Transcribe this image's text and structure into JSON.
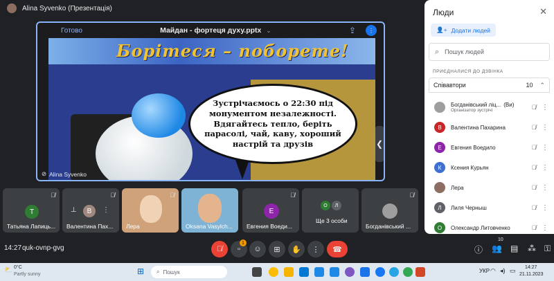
{
  "meeting": {
    "presenter_label": "Alina Syvenko (Презентація)",
    "stage_status": "Готово",
    "file_name": "Майдан - фортеця духу.pptx",
    "slide_headline": "Борітеся – поборете!",
    "slide_text": "Зустрічаємось о 22:30 під монументом незалежності. Вдягайтесь тепло, беріть парасолі, чай, каву, хороший настрій та друзів",
    "presenter_name": "Alina Syvenko"
  },
  "tiles": [
    {
      "name": "Татьяна Лапиць...",
      "initial": "T",
      "color": "#2e7d32"
    },
    {
      "name": "Валентина Пах...",
      "initial": "В",
      "color": "#a1887f"
    },
    {
      "name": "Лера",
      "initial": "",
      "color": ""
    },
    {
      "name": "Oksana Vasylch...",
      "initial": "",
      "color": ""
    },
    {
      "name": "Евгения Воеди...",
      "initial": "E",
      "color": "#8e24aa"
    },
    {
      "name": "Ще 3 особи",
      "initial": "",
      "color": ""
    },
    {
      "name": "Богданівський ...",
      "initial": "",
      "color": ""
    }
  ],
  "more_tile_initials": [
    "O",
    "Л"
  ],
  "bottom": {
    "time": "14:27",
    "meeting_code": "quk-ovnp-gvg",
    "participant_count": "10",
    "notification_badge": "1"
  },
  "people_panel": {
    "title": "Люди",
    "add_button": "Додати людей",
    "search_placeholder": "Пошук людей",
    "joined_header": "ПРИЄДНАЛИСЯ ДО ДЗВІНКА",
    "group_label": "Співавтори",
    "group_count": "10",
    "people": [
      {
        "name": "Богданівський ліц...",
        "suffix": "(Ви)",
        "role": "Організатор зустрічі",
        "initial": "",
        "color": "#9e9e9e"
      },
      {
        "name": "Валентина Пахарина",
        "suffix": "",
        "role": "",
        "initial": "В",
        "color": "#c62828"
      },
      {
        "name": "Евгения Воедило",
        "suffix": "",
        "role": "",
        "initial": "Е",
        "color": "#8e24aa"
      },
      {
        "name": "Ксения Курьян",
        "suffix": "",
        "role": "",
        "initial": "К",
        "color": "#3f6fd1"
      },
      {
        "name": "Лера",
        "suffix": "",
        "role": "",
        "initial": "",
        "color": "#8d6e63"
      },
      {
        "name": "Лиля Черныш",
        "suffix": "",
        "role": "",
        "initial": "Л",
        "color": "#5f6368"
      },
      {
        "name": "Олександр Литовченко",
        "suffix": "",
        "role": "",
        "initial": "О",
        "color": "#2e7d32"
      }
    ]
  },
  "taskbar": {
    "weather_temp": "0°C",
    "weather_desc": "Partly sunny",
    "search_placeholder": "Пошук",
    "lang": "УКР",
    "time": "14:27",
    "date": "21.11.2023"
  }
}
